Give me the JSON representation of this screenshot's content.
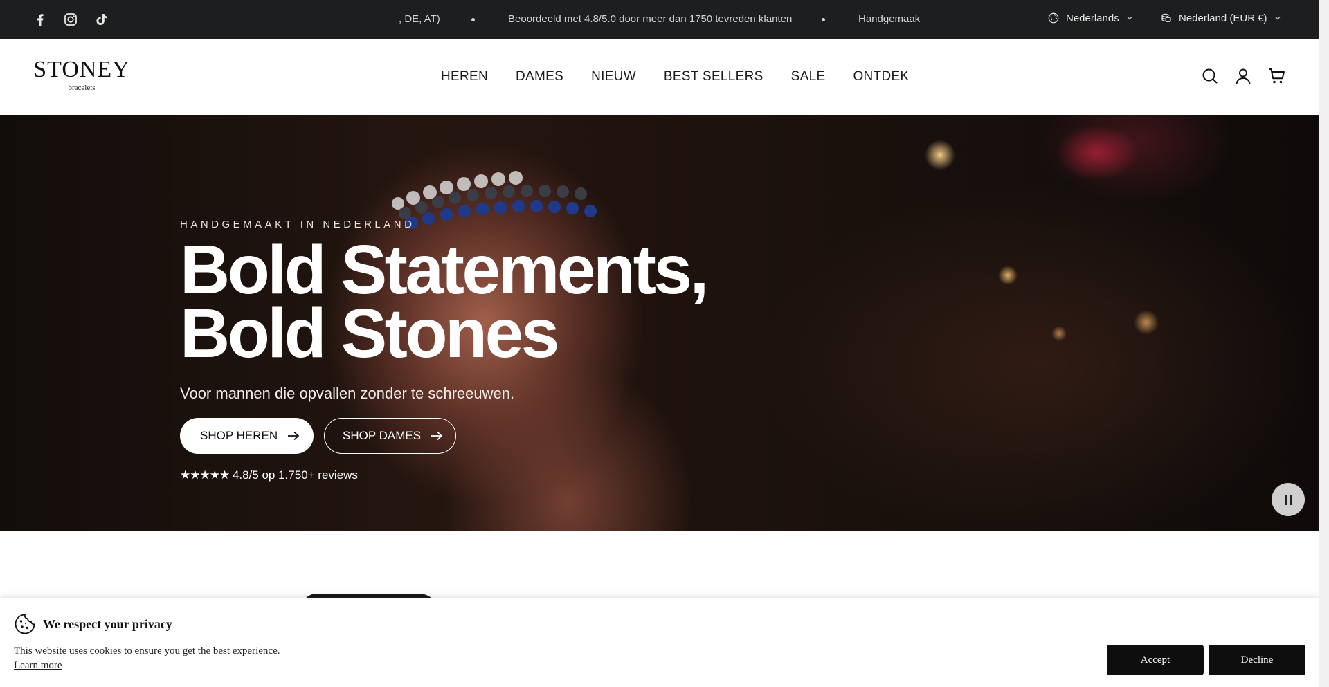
{
  "topbar": {
    "ticker_left": ", DE, AT)",
    "ticker_center": "Beoordeeld met 4.8/5.0 door meer dan 1750 tevreden klanten",
    "ticker_right": "Handgemaak",
    "language": "Nederlands",
    "country": "Nederland (EUR €)",
    "social_icons": [
      "facebook-icon",
      "instagram-icon",
      "tiktok-icon"
    ]
  },
  "header": {
    "logo_main": "STONEY",
    "logo_sub": "bracelets",
    "nav": [
      "HEREN",
      "DAMES",
      "NIEUW",
      "BEST SELLERS",
      "SALE",
      "ONTDEK"
    ],
    "icons": [
      "search-icon",
      "account-icon",
      "cart-icon"
    ]
  },
  "hero": {
    "eyebrow": "HANDGEMAAKT IN NEDERLAND",
    "headline": "Bold Statements, Bold Stones",
    "subline": "Voor mannen die opvallen zonder te schreeuwen.",
    "btn_heren": "SHOP HEREN",
    "btn_dames": "SHOP DAMES",
    "stars": "★★★★★",
    "rating": "4.8/5 op 1.750+ reviews"
  },
  "cookie": {
    "title": "We respect your privacy",
    "text": "This website uses cookies to ensure you get the best experience.",
    "link": "Learn more",
    "accept": "Accept",
    "decline": "Decline"
  },
  "colors": {
    "topbar_bg": "#1d1e20",
    "button_dark": "#0e0e0e",
    "white": "#ffffff"
  }
}
